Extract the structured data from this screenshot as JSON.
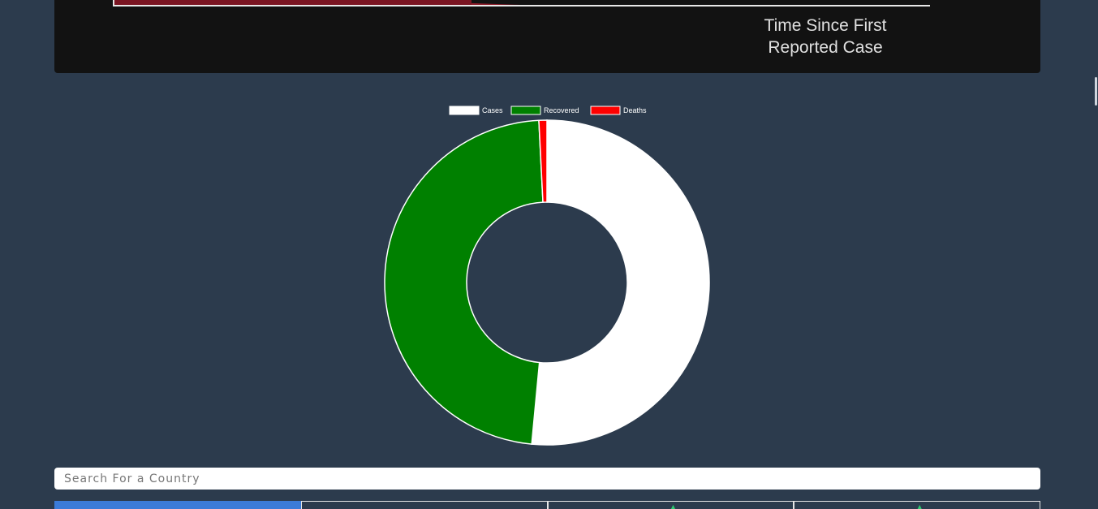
{
  "top_chart": {
    "xaxis_title_line1": "Time Since First",
    "xaxis_title_line2": "Reported Case"
  },
  "chart_data": {
    "type": "doughnut",
    "legend": [
      "Cases",
      "Recovered",
      "Deaths"
    ],
    "legend_position": "top",
    "series": [
      {
        "name": "Cases",
        "value": 51.5,
        "color": "#ffffff"
      },
      {
        "name": "Recovered",
        "value": 47.7,
        "color": "#008000"
      },
      {
        "name": "Deaths",
        "value": 0.8,
        "color": "#ff0000"
      }
    ]
  },
  "search": {
    "placeholder": "Search For a Country",
    "value": ""
  },
  "table": {
    "columns": 4,
    "active_column": 0
  },
  "colors": {
    "background": "#2c3b4d",
    "panel": "#121212",
    "active_tab": "#3b7bd8"
  }
}
